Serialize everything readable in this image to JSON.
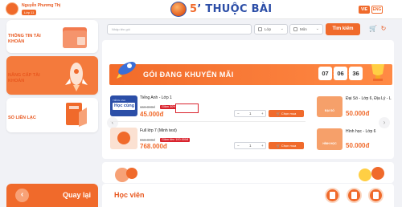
{
  "header": {
    "user_name": "Nguyễn Phương Thị",
    "user_grade": "Lớp 11",
    "logo_five": "5",
    "logo_text": "’ THUỘC BÀI",
    "lang_vie": "VIE",
    "lang_eng": "ENG"
  },
  "sidebar": {
    "items": [
      {
        "label": "THÔNG TIN TÀI KHOẢN"
      },
      {
        "label": "NÂNG CẤP TÀI KHOẢN"
      },
      {
        "label": "SỔ LIÊN LẠC"
      }
    ],
    "back_label": "Quay lại"
  },
  "search": {
    "placeholder": "Nhập tên gói",
    "grade_select": "Lớp",
    "subject_select": "Môn",
    "button": "Tìm kiếm"
  },
  "banner": {
    "title": "GÓI ĐANG KHUYẾN MÃI",
    "timer": [
      "07",
      "06",
      "36"
    ]
  },
  "products": [
    {
      "title": "Tiếng Anh - Lớp 1",
      "thumb_text": "Học cùng",
      "old_price": "150.000đ",
      "discount": "Giảm 30%",
      "new_price": "45.000đ",
      "qty": "1",
      "minus": "−",
      "plus": "+",
      "add_label": "Chọn mua"
    },
    {
      "title": "Full lớp 7 (Minh test)",
      "old_price": "868.000đ",
      "discount": "Giảm tiền 100.000đ",
      "new_price": "768.000đ",
      "qty": "1",
      "minus": "−",
      "plus": "+",
      "add_label": "Chọn mua"
    }
  ],
  "right_products": [
    {
      "title": "Đại Số - Lớp 6, Địa Lý - L",
      "thumb": "ĐẠI SỐ",
      "price": "50.000đ"
    },
    {
      "title": "Hình học - Lớp 6",
      "thumb": "HÌNH HỌC",
      "price": "50.000đ"
    }
  ],
  "footer": {
    "students_label": "Học viên"
  },
  "colors": {
    "accent": "#f06a2b",
    "brand_blue": "#2c4ea7",
    "sale_red": "#d9232d"
  }
}
